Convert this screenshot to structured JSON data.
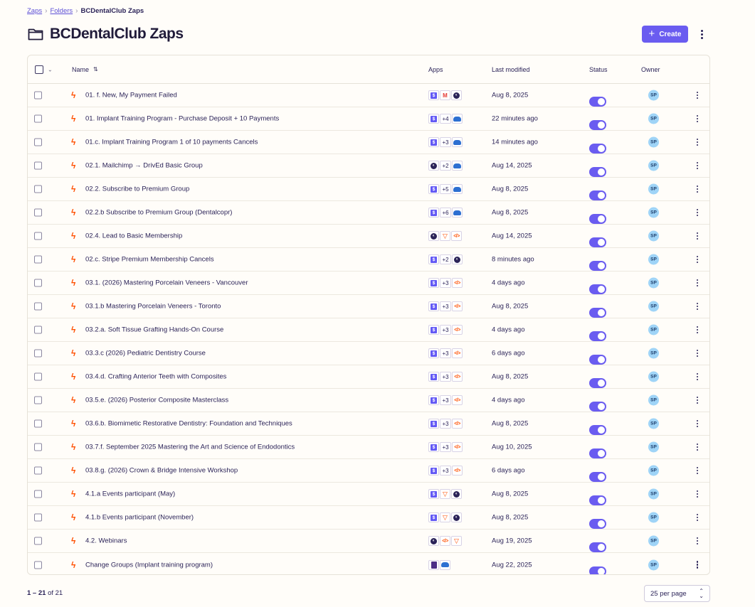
{
  "breadcrumb": {
    "items": [
      "Zaps",
      "Folders"
    ],
    "current": "BCDentalClub Zaps"
  },
  "header": {
    "title": "BCDentalClub Zaps",
    "create_label": "Create"
  },
  "table": {
    "columns": {
      "name": "Name",
      "apps": "Apps",
      "modified": "Last modified",
      "status": "Status",
      "owner": "Owner"
    },
    "rows": [
      {
        "name": "01. f. New, My Payment Failed",
        "apps": [
          "stripe",
          "gmail",
          "mailchimp"
        ],
        "count": "",
        "modified": "Aug 8, 2025",
        "status": true,
        "owner": "SP"
      },
      {
        "name": "01. Implant Training Program - Purchase Deposit + 10 Payments",
        "apps": [
          "stripe",
          "+4",
          "learn"
        ],
        "modified": "22 minutes ago",
        "status": true,
        "owner": "SP"
      },
      {
        "name": "01.c. Implant Training Program 1 of 10 payments Cancels",
        "apps": [
          "stripe",
          "+3",
          "learn"
        ],
        "modified": "14 minutes ago",
        "status": true,
        "owner": "SP"
      },
      {
        "name": "02.1. Mailchimp → DrivEd Basic Group",
        "apps": [
          "mailchimp",
          "+2",
          "learn"
        ],
        "modified": "Aug 14, 2025",
        "status": true,
        "owner": "SP"
      },
      {
        "name": "02.2. Subscribe to Premium Group",
        "apps": [
          "stripe",
          "+5",
          "learn"
        ],
        "modified": "Aug 8, 2025",
        "status": true,
        "owner": "SP"
      },
      {
        "name": "02.2.b Subscribe to Premium Group (Dentalcopr)",
        "apps": [
          "stripe",
          "+6",
          "learn"
        ],
        "modified": "Aug 8, 2025",
        "status": true,
        "owner": "SP"
      },
      {
        "name": "02.4. Lead to Basic Membership",
        "apps": [
          "mailchimp",
          "filter",
          "code"
        ],
        "modified": "Aug 14, 2025",
        "status": true,
        "owner": "SP"
      },
      {
        "name": "02.c. Stripe Premium Membership Cancels",
        "apps": [
          "stripe",
          "+2",
          "mailchimp"
        ],
        "modified": "8 minutes ago",
        "status": true,
        "owner": "SP"
      },
      {
        "name": "03.1. (2026) Mastering Porcelain Veneers - Vancouver",
        "apps": [
          "stripe",
          "+3",
          "code"
        ],
        "modified": "4 days ago",
        "status": true,
        "owner": "SP"
      },
      {
        "name": "03.1.b Mastering Porcelain Veneers - Toronto",
        "apps": [
          "stripe",
          "+3",
          "code"
        ],
        "modified": "Aug 8, 2025",
        "status": true,
        "owner": "SP"
      },
      {
        "name": "03.2.a. Soft Tissue Grafting Hands-On Course",
        "apps": [
          "stripe",
          "+3",
          "code"
        ],
        "modified": "4 days ago",
        "status": true,
        "owner": "SP"
      },
      {
        "name": "03.3.c (2026) Pediatric Dentistry Course",
        "apps": [
          "stripe",
          "+3",
          "code"
        ],
        "modified": "6 days ago",
        "status": true,
        "owner": "SP"
      },
      {
        "name": "03.4.d. Crafting Anterior Teeth with Composites",
        "apps": [
          "stripe",
          "+3",
          "code"
        ],
        "modified": "Aug 8, 2025",
        "status": true,
        "owner": "SP"
      },
      {
        "name": "03.5.e. (2026) Posterior Composite Masterclass",
        "apps": [
          "stripe",
          "+3",
          "code"
        ],
        "modified": "4 days ago",
        "status": true,
        "owner": "SP"
      },
      {
        "name": "03.6.b. Biomimetic Restorative Dentistry: Foundation and Techniques",
        "apps": [
          "stripe",
          "+3",
          "code"
        ],
        "modified": "Aug 8, 2025",
        "status": true,
        "owner": "SP"
      },
      {
        "name": "03.7.f. September 2025 Mastering the Art and Science of Endodontics",
        "apps": [
          "stripe",
          "+3",
          "code"
        ],
        "modified": "Aug 10, 2025",
        "status": true,
        "owner": "SP"
      },
      {
        "name": "03.8.g. (2026) Crown & Bridge Intensive Workshop",
        "apps": [
          "stripe",
          "+3",
          "code"
        ],
        "modified": "6 days ago",
        "status": true,
        "owner": "SP"
      },
      {
        "name": "4.1.a Events participant (May)",
        "apps": [
          "stripe",
          "filter",
          "mailchimp"
        ],
        "modified": "Aug 8, 2025",
        "status": true,
        "owner": "SP"
      },
      {
        "name": "4.1.b Events participant (November)",
        "apps": [
          "stripe",
          "filter",
          "mailchimp"
        ],
        "modified": "Aug 8, 2025",
        "status": true,
        "owner": "SP"
      },
      {
        "name": "4.2. Webinars",
        "apps": [
          "mailchimp",
          "code",
          "filter"
        ],
        "modified": "Aug 19, 2025",
        "status": true,
        "owner": "SP"
      },
      {
        "name": "Change Groups (Implant training program)",
        "apps": [
          "notion",
          "learn"
        ],
        "modified": "Aug 22, 2025",
        "status": true,
        "owner": "SP"
      }
    ]
  },
  "footer": {
    "range": "1 – 21",
    "of_label": "of 21",
    "per_page": "25 per page"
  },
  "colors": {
    "accent": "#6a5cf0",
    "zap_bolt": "#ff4f00"
  }
}
